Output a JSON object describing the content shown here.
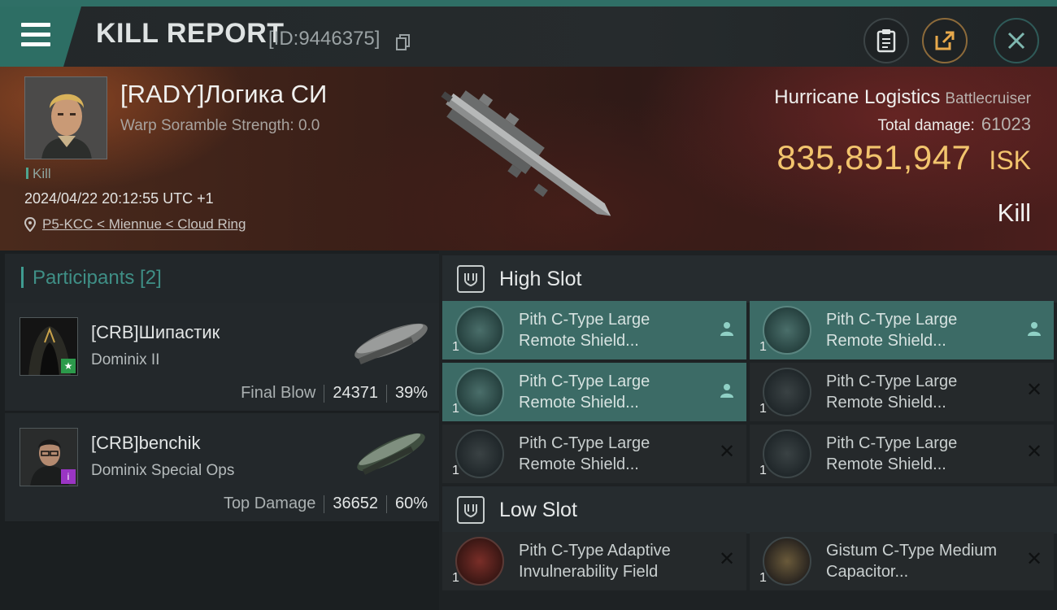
{
  "header": {
    "title": "KILL REPORT",
    "id_label": "[ID:9446375]"
  },
  "victim": {
    "name": "[RADY]Логика СИ",
    "warp_scramble": "Warp Soramble Strength: 0.0",
    "tag": "Kill",
    "datetime": "2024/04/22 20:12:55 UTC +1",
    "location": "P5-KCC < Miennue < Cloud Ring",
    "ship_name": "Hurricane Logistics",
    "ship_class": "Battlecruiser",
    "total_damage_label": "Total damage:",
    "total_damage_value": "61023",
    "isk_value": "835,851,947",
    "isk_unit": "ISK",
    "result": "Kill"
  },
  "participants": {
    "title": "Participants [2]",
    "items": [
      {
        "name": "[CRB]Шипастик",
        "ship": "Dominix II",
        "role": "Final Blow",
        "damage": "24371",
        "percent": "39%",
        "badge": "star-icon",
        "badge_color": "#2c9a4b"
      },
      {
        "name": "[CRB]benchik",
        "ship": "Dominix Special Ops",
        "role": "Top Damage",
        "damage": "36652",
        "percent": "60%",
        "badge": "info-icon",
        "badge_color": "#9a35c4"
      }
    ]
  },
  "slots": {
    "high": {
      "title": "High Slot",
      "modules": [
        {
          "qty": "1",
          "name": "Pith C-Type Large Remote Shield...",
          "state": "person-icon"
        },
        {
          "qty": "1",
          "name": "Pith C-Type Large Remote Shield...",
          "state": "person-icon"
        },
        {
          "qty": "1",
          "name": "Pith C-Type Large Remote Shield...",
          "state": "person-icon"
        },
        {
          "qty": "1",
          "name": "Pith C-Type Large Remote Shield...",
          "state": "destroyed-x-icon"
        },
        {
          "qty": "1",
          "name": "Pith C-Type Large Remote Shield...",
          "state": "destroyed-x-icon"
        },
        {
          "qty": "1",
          "name": "Pith C-Type Large Remote Shield...",
          "state": "destroyed-x-icon"
        }
      ]
    },
    "low": {
      "title": "Low Slot",
      "modules": [
        {
          "qty": "1",
          "name": "Pith C-Type Adaptive Invulnerability Field",
          "state": "destroyed-x-icon"
        },
        {
          "qty": "1",
          "name": "Gistum C-Type Medium Capacitor...",
          "state": "destroyed-x-icon"
        }
      ]
    }
  },
  "colors": {
    "accent_teal": "#2f6f66",
    "isk_gold": "#f2c46d",
    "active_module": "#3c6b66"
  }
}
